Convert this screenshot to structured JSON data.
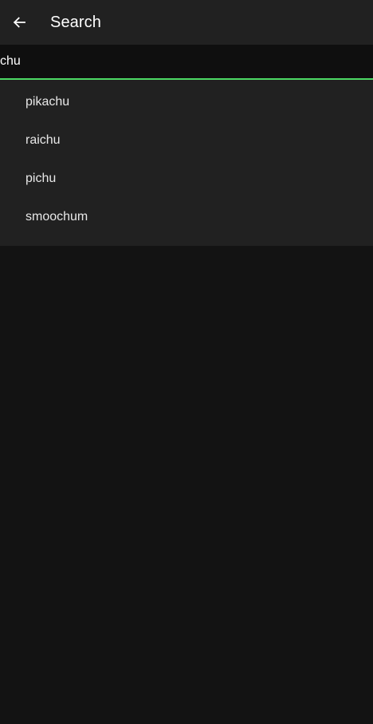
{
  "appbar": {
    "back_icon": "arrow-left-icon",
    "title": "Search"
  },
  "search": {
    "value": "chu",
    "accent_color": "#4cd964"
  },
  "suggestions": [
    {
      "label": "pikachu"
    },
    {
      "label": "raichu"
    },
    {
      "label": "pichu"
    },
    {
      "label": "smoochum"
    }
  ],
  "colors": {
    "background": "#131313",
    "appbar": "#212121",
    "suggestions_panel": "#212121",
    "text": "#ffffff"
  }
}
